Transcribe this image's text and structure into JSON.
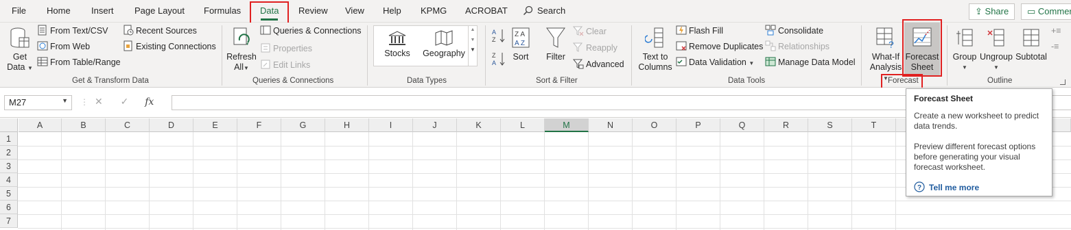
{
  "tabs": [
    "File",
    "Home",
    "Insert",
    "Page Layout",
    "Formulas",
    "Data",
    "Review",
    "View",
    "Help",
    "KPMG",
    "ACROBAT"
  ],
  "active_tab": "Data",
  "search_label": "Search",
  "share_label": "Share",
  "comments_label": "Commer",
  "ribbon": {
    "get_transform": {
      "get_data": [
        "Get",
        "Data"
      ],
      "from_text_csv": "From Text/CSV",
      "from_web": "From Web",
      "from_table_range": "From Table/Range",
      "recent_sources": "Recent Sources",
      "existing_connections": "Existing Connections",
      "label": "Get & Transform Data"
    },
    "queries": {
      "refresh_all": [
        "Refresh",
        "All"
      ],
      "queries_connections": "Queries & Connections",
      "properties": "Properties",
      "edit_links": "Edit Links",
      "label": "Queries & Connections"
    },
    "data_types": {
      "stocks": "Stocks",
      "geography": "Geography",
      "label": "Data Types"
    },
    "sort_filter": {
      "sort": "Sort",
      "filter": "Filter",
      "clear": "Clear",
      "reapply": "Reapply",
      "advanced": "Advanced",
      "label": "Sort & Filter"
    },
    "data_tools": {
      "text_to_columns": [
        "Text to",
        "Columns"
      ],
      "flash_fill": "Flash Fill",
      "remove_duplicates": "Remove Duplicates",
      "data_validation": "Data Validation",
      "consolidate": "Consolidate",
      "relationships": "Relationships",
      "manage_data_model": "Manage Data Model",
      "label": "Data Tools"
    },
    "forecast": {
      "what_if": [
        "What-If",
        "Analysis"
      ],
      "forecast_sheet": [
        "Forecast",
        "Sheet"
      ],
      "label": "Forecast"
    },
    "outline": {
      "group": "Group",
      "ungroup": "Ungroup",
      "subtotal": "Subtotal",
      "label": "Outline"
    }
  },
  "name_box": "M27",
  "fx_label": "fx",
  "columns": [
    "A",
    "B",
    "C",
    "D",
    "E",
    "F",
    "G",
    "H",
    "I",
    "J",
    "K",
    "L",
    "M",
    "N",
    "O",
    "P",
    "Q",
    "R",
    "S",
    "T"
  ],
  "selected_column": "M",
  "rows": [
    "1",
    "2",
    "3",
    "4",
    "5",
    "6",
    "7"
  ],
  "tooltip": {
    "title": "Forecast Sheet",
    "paragraph1": "Create a new worksheet to predict data trends.",
    "paragraph2": "Preview different forecast options before generating your visual forecast worksheet.",
    "tell_me_more": "Tell me more"
  },
  "colors": {
    "excel_green": "#217346",
    "highlight_red": "#e02020",
    "ribbon_bg": "#f3f2f1"
  }
}
